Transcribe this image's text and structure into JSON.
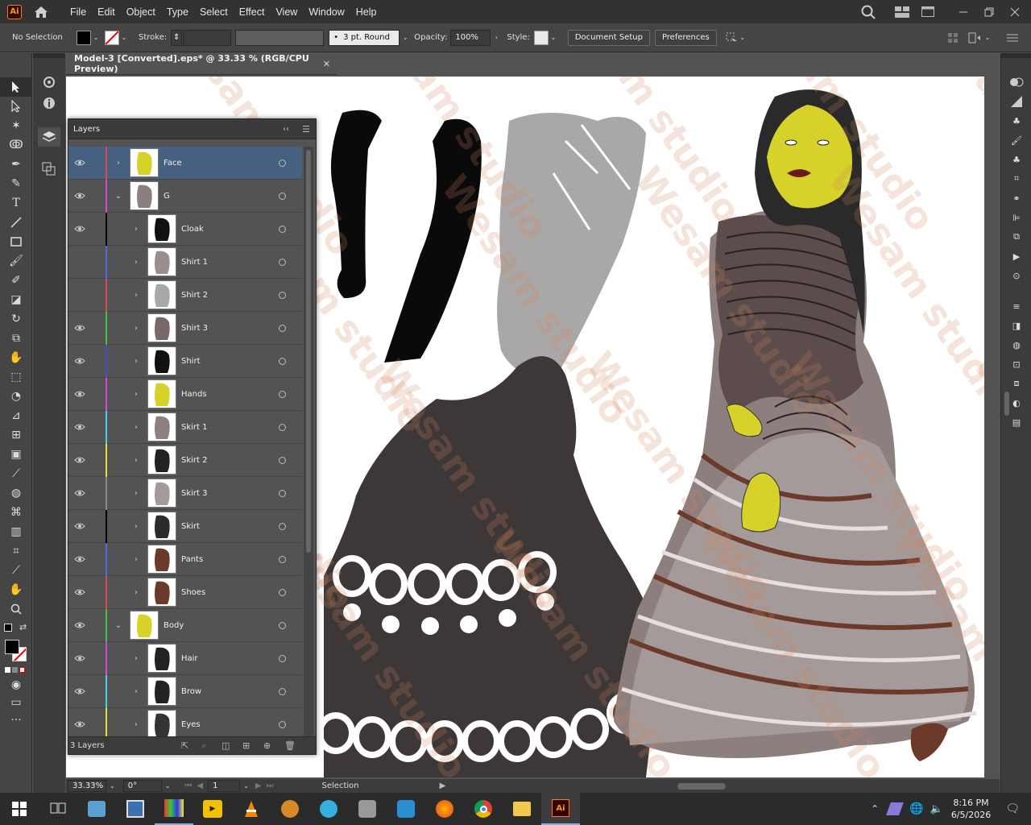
{
  "app": {
    "logo": "Ai",
    "menus": [
      "File",
      "Edit",
      "Object",
      "Type",
      "Select",
      "Effect",
      "View",
      "Window",
      "Help"
    ]
  },
  "control_bar": {
    "selection_status": "No Selection",
    "stroke_label": "Stroke:",
    "brush_value": "3 pt. Round",
    "opacity_label": "Opacity:",
    "opacity_value": "100%",
    "style_label": "Style:",
    "document_setup": "Document Setup",
    "preferences": "Preferences"
  },
  "document": {
    "tab_title": "Model-3 [Converted].eps* @ 33.33 % (RGB/CPU Preview)",
    "close": "✕",
    "watermark": "Wesam studio"
  },
  "layers_panel": {
    "title": "Layers",
    "collapse": "‹‹",
    "menu": "☰",
    "footer_count": "3 Layers",
    "rows": [
      {
        "name": "Face",
        "color": "#e04848",
        "visible": true,
        "expanded": false,
        "indent": 0,
        "selected": true,
        "thumb": "face"
      },
      {
        "name": "G",
        "color": "#d946d6",
        "visible": true,
        "expanded": true,
        "indent": 0,
        "selected": false,
        "thumb": "g"
      },
      {
        "name": "Cloak",
        "color": "#000000",
        "visible": true,
        "expanded": false,
        "indent": 1,
        "selected": false,
        "thumb": "cloak"
      },
      {
        "name": "Shirt 1",
        "color": "#4a6ee0",
        "visible": false,
        "expanded": false,
        "indent": 1,
        "selected": false,
        "thumb": "shirt1"
      },
      {
        "name": "Shirt 2",
        "color": "#e04848",
        "visible": false,
        "expanded": false,
        "indent": 1,
        "selected": false,
        "thumb": "shirt2"
      },
      {
        "name": "Shirt 3",
        "color": "#3ec43e",
        "visible": true,
        "expanded": false,
        "indent": 1,
        "selected": false,
        "thumb": "shirt3"
      },
      {
        "name": "Shirt",
        "color": "#4a4ad0",
        "visible": true,
        "expanded": false,
        "indent": 1,
        "selected": false,
        "thumb": "shirt"
      },
      {
        "name": "Hands",
        "color": "#d946d6",
        "visible": true,
        "expanded": false,
        "indent": 1,
        "selected": false,
        "thumb": "hands"
      },
      {
        "name": "Skirt 1",
        "color": "#3ed6e0",
        "visible": true,
        "expanded": false,
        "indent": 1,
        "selected": false,
        "thumb": "skirt1"
      },
      {
        "name": "Skirt 2",
        "color": "#e6e03e",
        "visible": true,
        "expanded": false,
        "indent": 1,
        "selected": false,
        "thumb": "skirt2"
      },
      {
        "name": "Skirt 3",
        "color": "#888888",
        "visible": true,
        "expanded": false,
        "indent": 1,
        "selected": false,
        "thumb": "skirt3"
      },
      {
        "name": "Skirt",
        "color": "#000000",
        "visible": true,
        "expanded": false,
        "indent": 1,
        "selected": false,
        "thumb": "skirt"
      },
      {
        "name": "Pants",
        "color": "#4a6ee0",
        "visible": true,
        "expanded": false,
        "indent": 1,
        "selected": false,
        "thumb": "pants"
      },
      {
        "name": "Shoes",
        "color": "#e04848",
        "visible": true,
        "expanded": false,
        "indent": 1,
        "selected": false,
        "thumb": "shoes"
      },
      {
        "name": "Body",
        "color": "#3ec43e",
        "visible": true,
        "expanded": true,
        "indent": 0,
        "selected": false,
        "thumb": "body"
      },
      {
        "name": "Hair",
        "color": "#d946d6",
        "visible": true,
        "expanded": false,
        "indent": 1,
        "selected": false,
        "thumb": "hair"
      },
      {
        "name": "Brow",
        "color": "#3ed6e0",
        "visible": true,
        "expanded": false,
        "indent": 1,
        "selected": false,
        "thumb": "brow"
      },
      {
        "name": "Eyes",
        "color": "#e6e03e",
        "visible": true,
        "expanded": false,
        "indent": 1,
        "selected": false,
        "thumb": "eyes"
      }
    ]
  },
  "status_bar": {
    "zoom": "33.33%",
    "rotation": "0°",
    "artboard": "1",
    "tool": "Selection"
  },
  "taskbar": {
    "time": "8:16 PM",
    "date": "6/5/2026"
  }
}
